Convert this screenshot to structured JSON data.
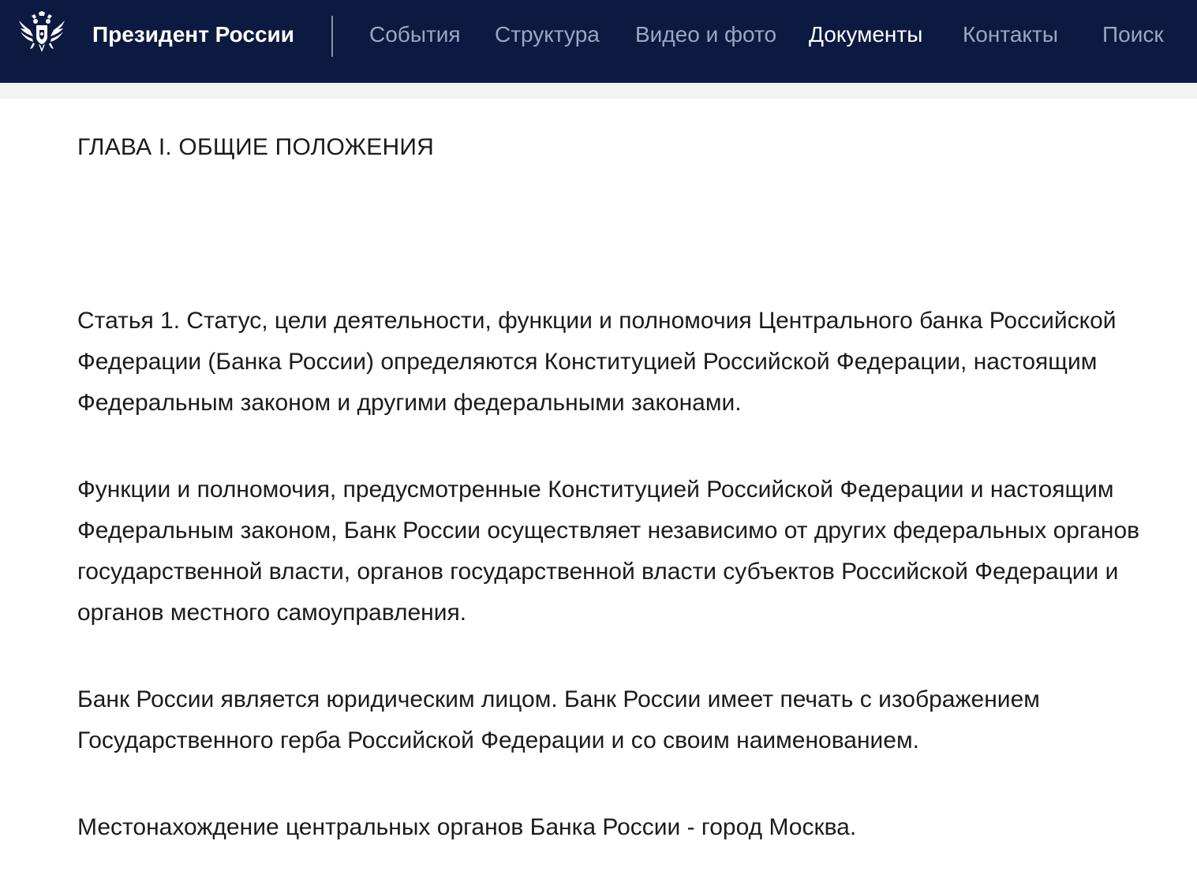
{
  "header": {
    "logo_icon": "russian-double-headed-eagle-icon",
    "site_title": "Президент России",
    "nav": [
      {
        "label": "События",
        "active": false
      },
      {
        "label": "Структура",
        "active": false
      },
      {
        "label": "Видео и фото",
        "active": false
      },
      {
        "label": "Документы",
        "active": true
      },
      {
        "label": "Контакты",
        "active": false
      },
      {
        "label": "Поиск",
        "active": false
      }
    ],
    "colors": {
      "background": "#0c1a41",
      "nav_inactive": "#9aa6c3",
      "nav_active": "#ffffff"
    }
  },
  "document": {
    "chapter_title": "ГЛАВА I. ОБЩИЕ ПОЛОЖЕНИЯ",
    "paragraphs": [
      "Статья 1. Статус, цели деятельности, функции и полномочия Центрального банка Российской Федерации (Банка России) определяются Конституцией Российской Федерации, настоящим Федеральным законом и другими федеральными законами.",
      "Функции и полномочия, предусмотренные Конституцией Российской Федерации и настоящим Федеральным законом, Банк России осуществляет независимо от других федеральных органов государственной власти, органов государственной власти субъектов Российской Федерации и органов местного самоуправления.",
      "Банк России является юридическим лицом. Банк России имеет печать с изображением Государственного герба Российской Федерации и со своим наименованием.",
      "Местонахождение центральных органов Банка России - город Москва."
    ]
  }
}
